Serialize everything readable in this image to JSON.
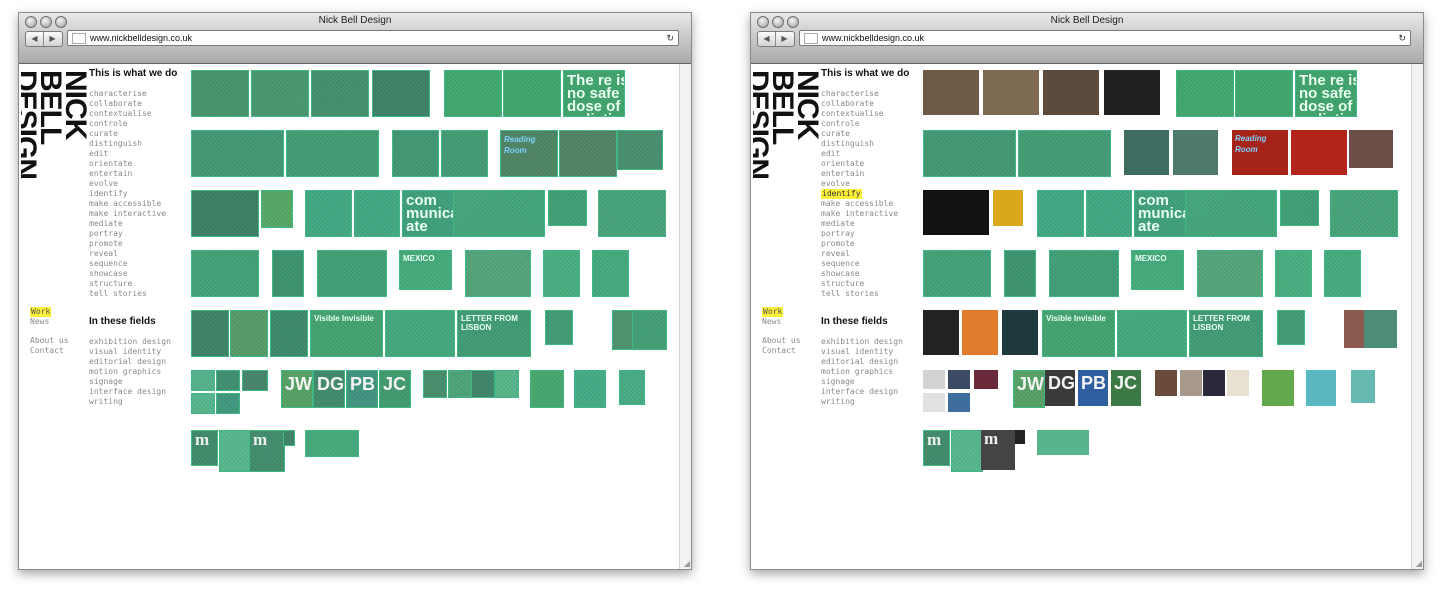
{
  "windows": [
    {
      "id": "w1",
      "window_title": "Nick Bell Design",
      "url": "www.nickbelldesign.co.uk",
      "logo": "NICK BELL DESIGN",
      "section_do": "This is what we do",
      "verbs": [
        "characterise",
        "collaborate",
        "contextualise",
        "controle",
        "curate",
        "distinguish",
        "edit",
        "orientate",
        "entertain",
        "evolve",
        "identify",
        "make accessible",
        "make interactive",
        "mediate",
        "portray",
        "promote",
        "reveal",
        "sequence",
        "showcase",
        "structure",
        "tell stories"
      ],
      "highlight_verb": "",
      "nav": [
        "Work",
        "News"
      ],
      "nav_selected": "Work",
      "about": [
        "About us",
        "Contact"
      ],
      "section_fields": "In these fields",
      "fields": [
        "exhibition design",
        "visual identity",
        "editorial design",
        "motion graphics",
        "signage",
        "interface design",
        "writing"
      ],
      "overlay_all": true
    },
    {
      "id": "w2",
      "window_title": "Nick Bell Design",
      "url": "www.nickbelldesign.co.uk",
      "logo": "NICK BELL DESIGN",
      "section_do": "This is what we do",
      "verbs": [
        "characterise",
        "collaborate",
        "contextualise",
        "controle",
        "curate",
        "distinguish",
        "edit",
        "orientate",
        "entertain",
        "evolve",
        "identify",
        "make accessible",
        "make interactive",
        "mediate",
        "portray",
        "promote",
        "reveal",
        "sequence",
        "showcase",
        "structure",
        "tell stories"
      ],
      "highlight_verb": "identify",
      "nav": [
        "Work",
        "News"
      ],
      "nav_selected": "Work",
      "about": [
        "About us",
        "Contact"
      ],
      "section_fields": "In these fields",
      "fields": [
        "exhibition design",
        "visual identity",
        "editorial design",
        "motion graphics",
        "signage",
        "interface design",
        "writing"
      ],
      "overlay_all": false
    }
  ],
  "thumb_texts": {
    "radiation": "The re is no safe dose of radiation",
    "reading_room": "Reading Room",
    "communicate": "com munica ate",
    "mexico": "MEXICO",
    "letter": "LETTER FROM LISBON",
    "visible": "Visible Invisible",
    "initials": [
      "JW",
      "DG",
      "PB",
      "JC"
    ],
    "mono": "m"
  },
  "colors": {
    "overlay_green": "#5cc89a",
    "highlight_yellow": "#fcf13a",
    "text_gray": "#8a8a8a"
  }
}
